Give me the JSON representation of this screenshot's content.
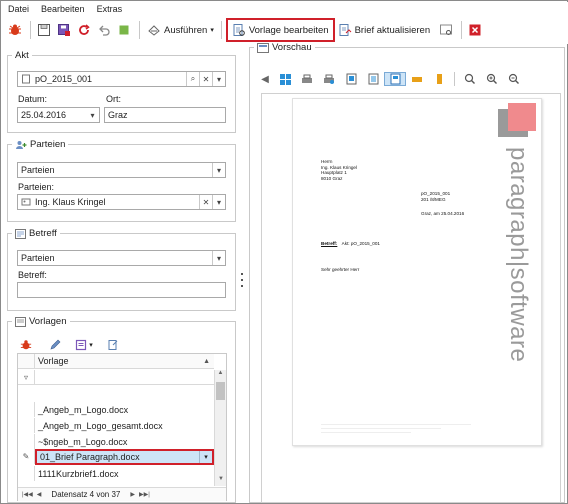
{
  "menu": {
    "items": [
      "Datei",
      "Bearbeiten",
      "Extras"
    ]
  },
  "toolbar": {
    "ausfuehren_label": "Ausführen",
    "vorlage_bearbeiten_label": "Vorlage bearbeiten",
    "brief_aktualisieren_label": "Brief aktualisieren"
  },
  "akt": {
    "title": "Akt",
    "akt_value": "pO_2015_001",
    "datum_label": "Datum:",
    "datum_value": "25.04.2016",
    "ort_label": "Ort:",
    "ort_value": "Graz"
  },
  "parteien": {
    "title": "Parteien",
    "dropdown_value": "Parteien",
    "list_label": "Parteien:",
    "partei_value": "Ing. Klaus Kringel"
  },
  "betreff": {
    "title": "Betreff",
    "dropdown_value": "Parteien",
    "field_label": "Betreff:",
    "field_value": ""
  },
  "vorlagen": {
    "title": "Vorlagen",
    "column_header": "Vorlage",
    "rows": [
      "_Angeb_m_Logo.docx",
      "_Angeb_m_Logo_gesamt.docx",
      "~$ngeb_m_Logo.docx",
      "01_Brief Paragraph.docx",
      "1111Kurzbrief1.docx"
    ],
    "selected_index": 3,
    "navigator_text": "Datensatz 4 von 37"
  },
  "preview": {
    "title": "Vorschau",
    "logo_text": "paragraph|software",
    "address": [
      "Herrn",
      "Ing. Klaus Kringel",
      "Hauptplatz 1",
      "8010 Graz"
    ],
    "ref": [
      "pO_2015_001",
      "201 /8/MEG"
    ],
    "place_date": "Graz, am 25.04.2016",
    "betreff_label": "Betreff:",
    "betreff_value": "Akt: pO_2015_001",
    "salutation": "Sehr geehrter Herr"
  },
  "colors": {
    "accent_red": "#d0202a",
    "selection_blue": "#cde4f7",
    "logo_pink": "#f08a8d",
    "logo_gray": "#9a9a9a"
  }
}
